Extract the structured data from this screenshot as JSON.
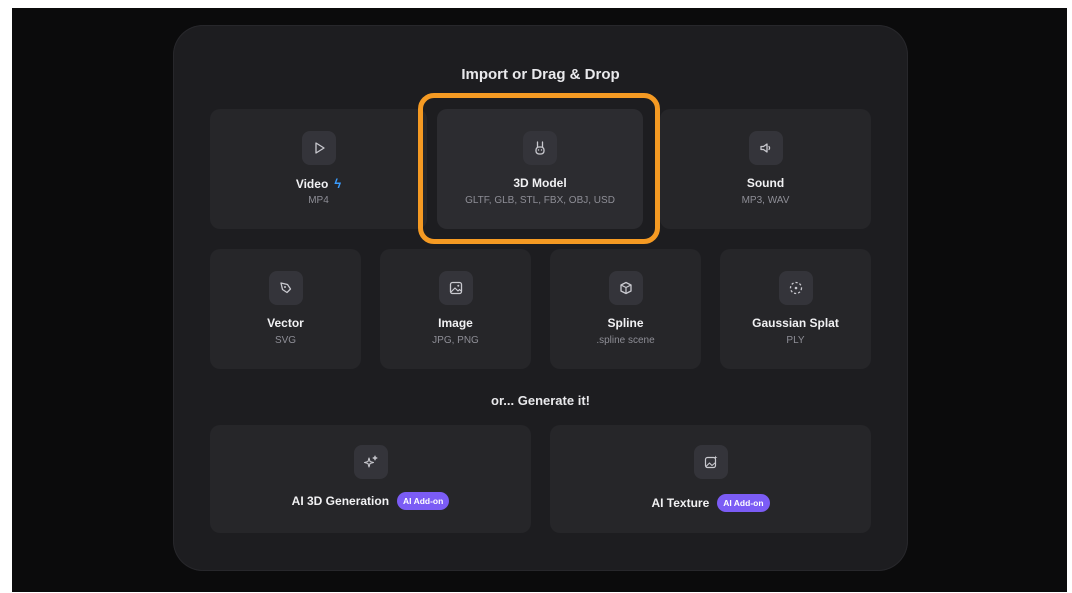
{
  "dialog": {
    "import_heading": "Import or Drag & Drop",
    "generate_heading": "or... Generate it!"
  },
  "import_row1": [
    {
      "title": "Video",
      "sub": "MP4",
      "icon": "play-icon",
      "extra_icon": "lightning-icon"
    },
    {
      "title": "3D Model",
      "sub": "GLTF, GLB, STL, FBX, OBJ, USD",
      "icon": "rabbit-icon",
      "selected": true
    },
    {
      "title": "Sound",
      "sub": "MP3, WAV",
      "icon": "speaker-icon"
    }
  ],
  "import_row2": [
    {
      "title": "Vector",
      "sub": "SVG",
      "icon": "pen-tool-icon"
    },
    {
      "title": "Image",
      "sub": "JPG, PNG",
      "icon": "image-icon"
    },
    {
      "title": "Spline",
      "sub": ".spline scene",
      "icon": "cube-icon"
    },
    {
      "title": "Gaussian Splat",
      "sub": "PLY",
      "icon": "splat-icon"
    }
  ],
  "generate": [
    {
      "title": "AI 3D Generation",
      "badge": "AI Add-on",
      "icon": "sparkles-icon"
    },
    {
      "title": "AI Texture",
      "badge": "AI Add-on",
      "icon": "image-sparkle-icon"
    }
  ],
  "colors": {
    "highlight": "#f59a23",
    "badge": "#7b5cf5",
    "bolt": "#3b9dff"
  }
}
